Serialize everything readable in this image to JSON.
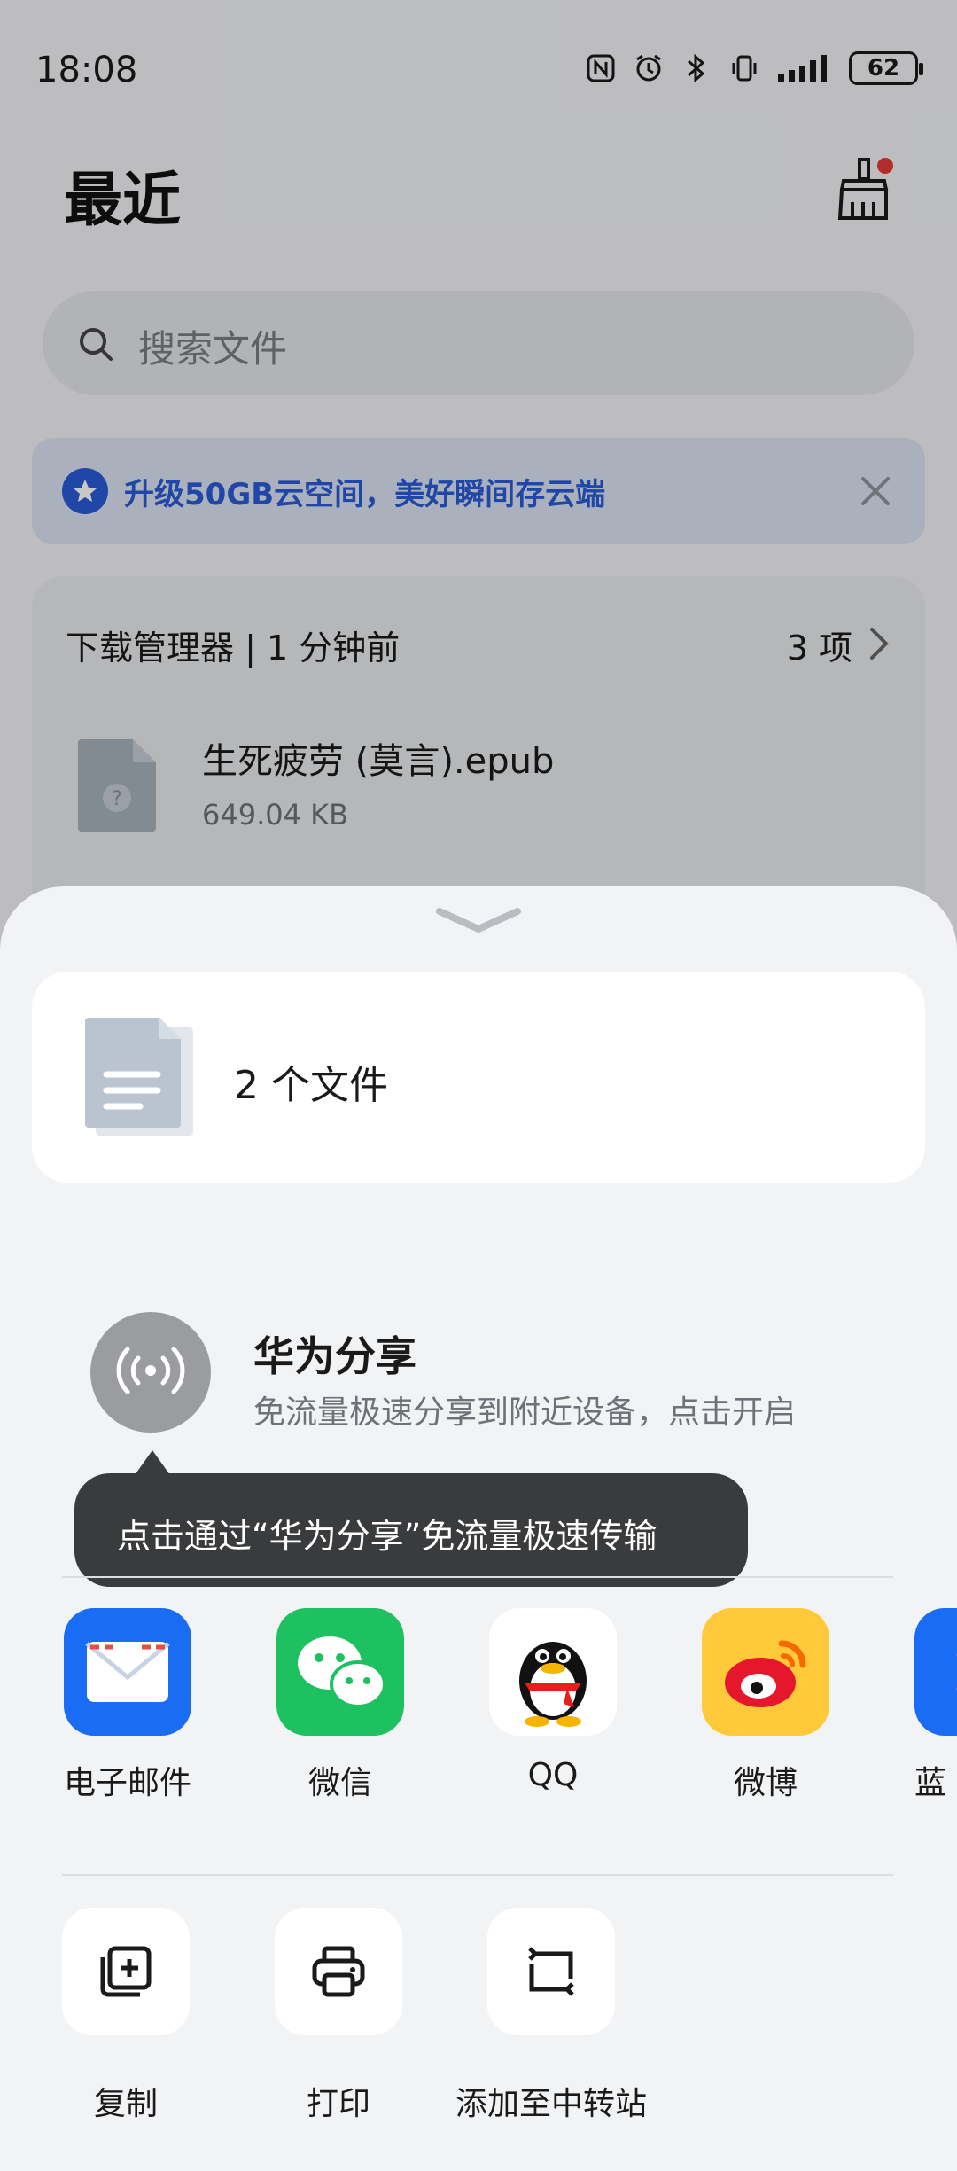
{
  "status_bar": {
    "time": "18:08",
    "battery": "62"
  },
  "header": {
    "title": "最近"
  },
  "search": {
    "placeholder": "搜索文件"
  },
  "banner": {
    "text": "升级50GB云空间，美好瞬间存云端",
    "accent": "#2a5bd7"
  },
  "recent_card": {
    "title": "下载管理器 | 1 分钟前",
    "count": "3 项",
    "file": {
      "name": "生死疲劳 (莫言).epub",
      "size": "649.04 KB"
    }
  },
  "share_sheet": {
    "files_label": "2 个文件",
    "huawei_share": {
      "title": "华为分享",
      "subtitle": "免流量极速分享到附近设备，点击开启",
      "tooltip": "点击通过“华为分享”免流量极速传输"
    },
    "apps": [
      {
        "label": "电子邮件",
        "icon": "mail-icon",
        "color": "#1a6cf5"
      },
      {
        "label": "微信",
        "icon": "wechat-icon",
        "color": "#1ec15f"
      },
      {
        "label": "QQ",
        "icon": "qq-icon",
        "color": "#ffffff"
      },
      {
        "label": "微博",
        "icon": "weibo-icon",
        "color": "#ffc93a"
      },
      {
        "label": "蓝",
        "icon": "bluetooth-icon",
        "color": "#1a6cf5"
      }
    ],
    "actions": [
      {
        "label": "复制",
        "icon": "copy-icon"
      },
      {
        "label": "打印",
        "icon": "print-icon"
      },
      {
        "label": "添加至中转站",
        "icon": "transfer-icon"
      }
    ]
  }
}
